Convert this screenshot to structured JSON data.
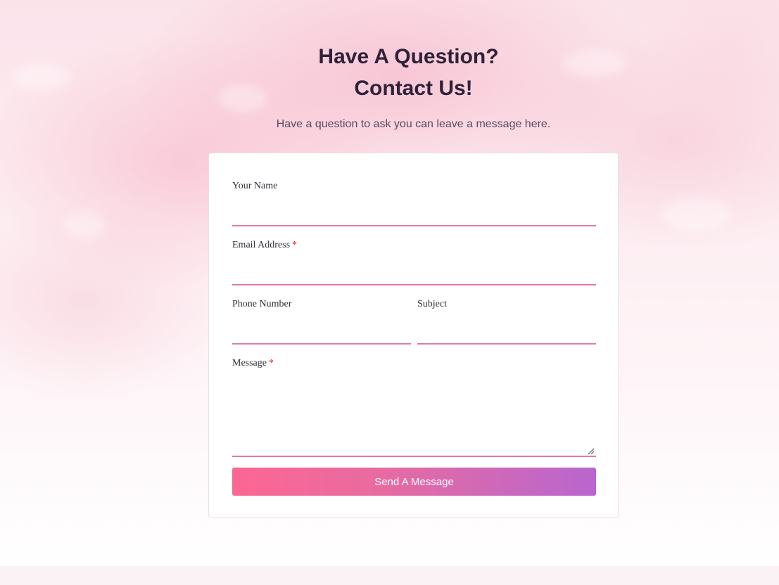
{
  "header": {
    "title_line1": "Have A Question?",
    "title_line2": "Contact Us!",
    "subtitle": "Have a question to ask you can leave a message here."
  },
  "form": {
    "name": {
      "label": "Your Name",
      "value": ""
    },
    "email": {
      "label": "Email Address",
      "required_mark": "*",
      "value": ""
    },
    "phone": {
      "label": "Phone Number",
      "value": ""
    },
    "subject": {
      "label": "Subject",
      "value": ""
    },
    "message": {
      "label": "Message",
      "required_mark": "*",
      "value": ""
    },
    "submit_label": "Send A Message"
  },
  "colors": {
    "heading": "#2e2239",
    "field_underline": "#e179a8",
    "required": "#e8202a",
    "button_gradient_start": "#fc6794",
    "button_gradient_end": "#b866cf"
  }
}
